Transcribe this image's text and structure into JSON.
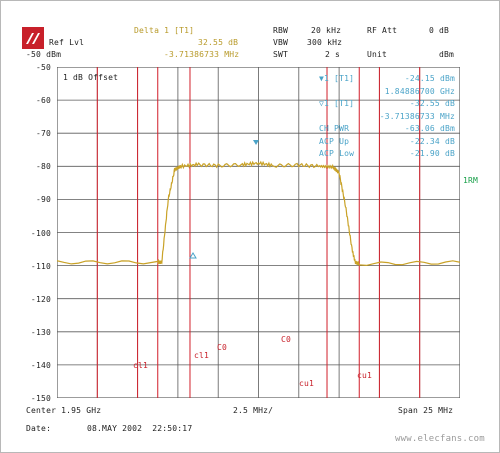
{
  "header": {
    "marker_label": "Delta 1 [T1]",
    "marker_level": "32.55 dB",
    "marker_freq": "-3.71386733 MHz",
    "ref_lvl_label": "Ref Lvl",
    "ref_lvl_value": "-50 dBm",
    "rbw_label": "RBW",
    "rbw_value": "20 kHz",
    "vbw_label": "VBW",
    "vbw_value": "300 kHz",
    "swt_label": "SWT",
    "swt_value": "2 s",
    "rf_att_label": "RF Att",
    "rf_att_value": "0 dB",
    "unit_label": "Unit",
    "unit_value": "dBm"
  },
  "offset_label": "1 dB Offset",
  "rm_label": "1RM",
  "marker_panel": [
    {
      "label": "▼1 [T1]",
      "value": "-24.15 dBm"
    },
    {
      "label": "",
      "value": "1.84886700 GHz"
    },
    {
      "label": "▽1 [T1]",
      "value": "-32.55 dB"
    },
    {
      "label": "",
      "value": "-3.71386733 MHz"
    },
    {
      "label": "CH PWR",
      "value": "-63.06 dBm"
    },
    {
      "label": "ACP Up",
      "value": "-22.34 dB"
    },
    {
      "label": "ACP Low",
      "value": "-21.90 dB"
    }
  ],
  "y_axis": [
    "-50",
    "-60",
    "-70",
    "-80",
    "-90",
    "-100",
    "-110",
    "-120",
    "-130",
    "-140",
    "-150"
  ],
  "channel_labels": [
    "cl1",
    "cl1",
    "C0",
    "C0",
    "cu1",
    "cu1"
  ],
  "footer": {
    "center": "Center 1.95 GHz",
    "span_div": "2.5 MHz/",
    "span": "Span 25 MHz",
    "date_label": "Date:",
    "date_value": "08.MAY 2002  22:50:17",
    "watermark": "www.elecfans.com"
  },
  "colors": {
    "trace": "#c9a227",
    "grid": "#5a5a5a",
    "channel_lines": "#d21f2a",
    "marker_text": "#4aa3c8",
    "label_text": "#b89a2a"
  },
  "chart_data": {
    "type": "line",
    "x": [
      -12.5,
      -6.25,
      -6.0,
      -5.6,
      -5.2,
      -4.8,
      -3.8,
      -2.5,
      -1.0,
      0.0,
      1.0,
      2.5,
      3.8,
      4.6,
      5.0,
      5.4,
      5.8,
      6.0,
      6.25,
      12.5
    ],
    "series": [
      {
        "values": [
          -109,
          -109,
          -109,
          -90,
          -81,
          -80,
          -79.5,
          -79.8,
          -79.5,
          -79,
          -79.8,
          -79.6,
          -80,
          -80.2,
          -82,
          -92,
          -105,
          -109,
          -109.5,
          -109
        ]
      }
    ],
    "xlabel": "2.5 MHz/",
    "ylabel": "dBm",
    "xlim": [
      -12.5,
      12.5
    ],
    "ylim": [
      -150,
      -50
    ]
  }
}
